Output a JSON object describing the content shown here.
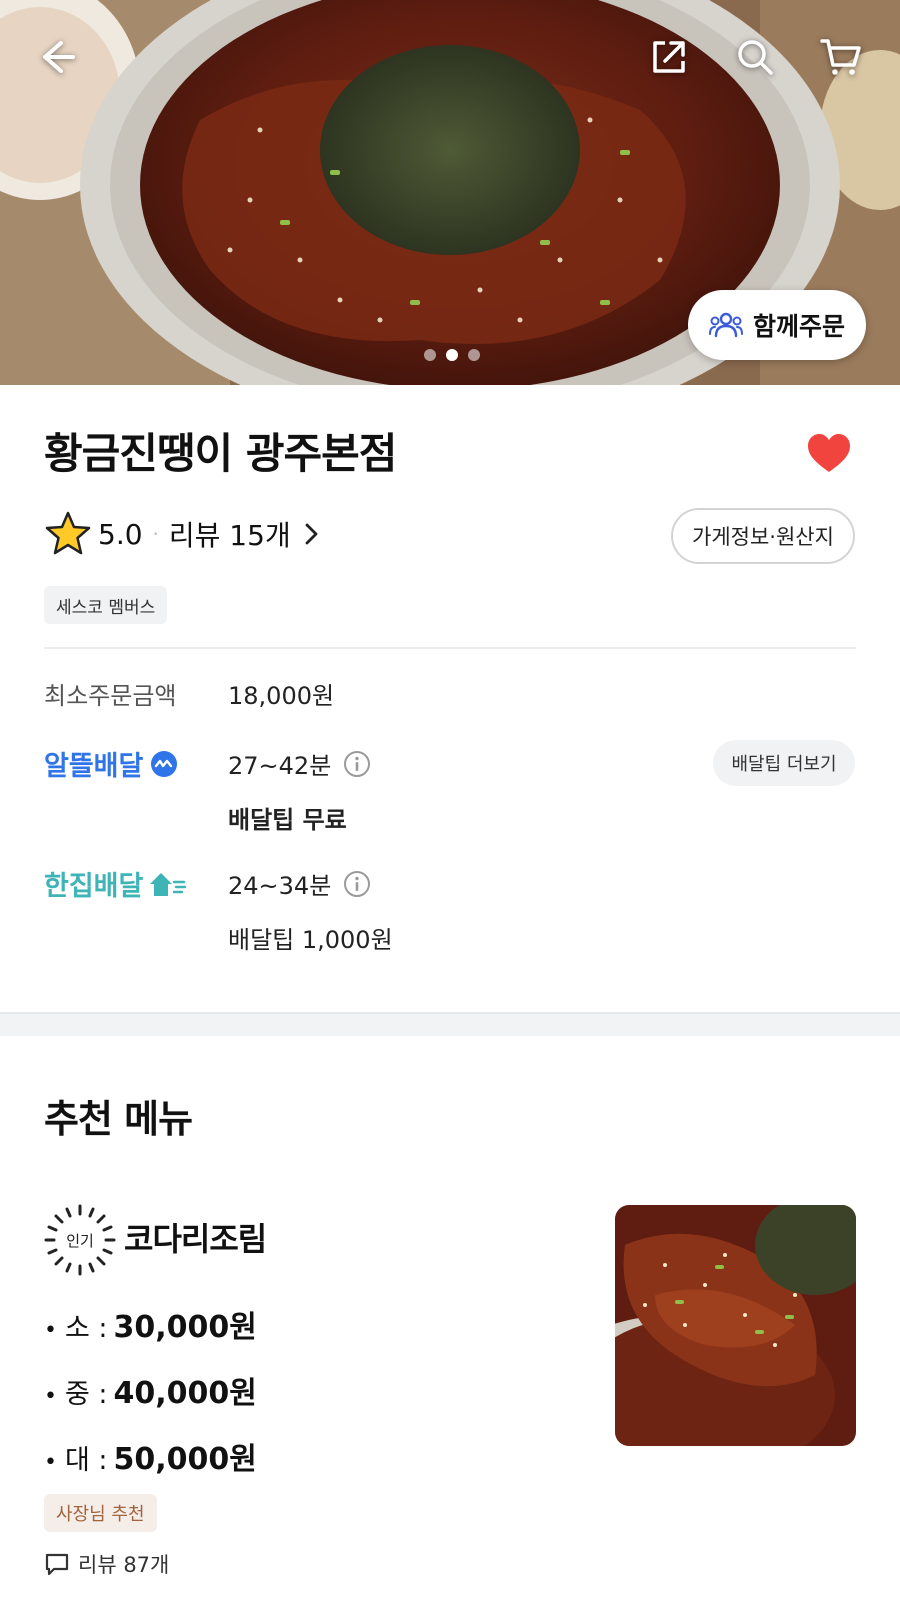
{
  "header": {
    "back_icon": "back-arrow-icon",
    "share_icon": "share-icon",
    "search_icon": "search-icon",
    "cart_icon": "cart-icon",
    "together_order_label": "함께주문",
    "carousel_index": 2,
    "carousel_total": 3
  },
  "store": {
    "name": "황금진땡이 광주본점",
    "favorited": true,
    "rating": "5.0",
    "review_label": "리뷰 15개",
    "info_button": "가게정보·원산지",
    "member_badge": "세스코 멤버스",
    "min_order_label": "최소주문금액",
    "min_order_value": "18,000원"
  },
  "delivery": {
    "saver": {
      "brand": "알뜰배달",
      "time": "27~42분",
      "tip": "배달팁 무료",
      "tip_more_button": "배달팁 더보기"
    },
    "single": {
      "brand": "한집배달",
      "time": "24~34분",
      "tip": "배달팁 1,000원"
    }
  },
  "recommended": {
    "section_title": "추천 메뉴",
    "items": [
      {
        "popular_badge": "인기",
        "name": "코다리조림",
        "prices": [
          {
            "size": "소 :",
            "price": "30,000원"
          },
          {
            "size": "중 :",
            "price": "40,000원"
          },
          {
            "size": "대 :",
            "price": "50,000원"
          }
        ],
        "owner_badge": "사장님 추천",
        "review_label": "리뷰 87개"
      }
    ]
  },
  "colors": {
    "saver_blue": "#2f74e8",
    "single_teal": "#3fb4b6",
    "heart_red": "#f2443f",
    "owner_badge_text": "#a0643f"
  }
}
